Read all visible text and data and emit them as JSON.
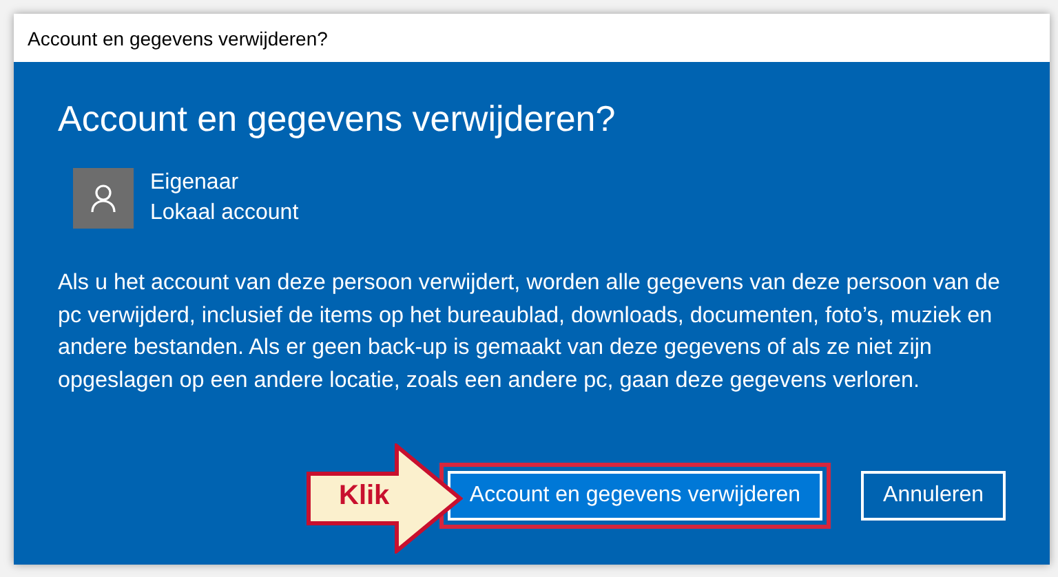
{
  "window": {
    "title": "Account en gegevens verwijderen?"
  },
  "heading": "Account en gegevens verwijderen?",
  "account": {
    "name": "Eigenaar",
    "type": "Lokaal account"
  },
  "message": "Als u het account van deze persoon verwijdert, worden alle gegevens van deze persoon van de pc verwijderd, inclusief de items op het bureaublad, downloads, documenten, foto’s, muziek en andere bestanden. Als er geen back-up is gemaakt van deze gegevens of als ze niet zijn opgeslagen op een andere locatie, zoals een andere pc, gaan deze gegevens verloren.",
  "buttons": [
    {
      "label": "Account en gegevens verwijderen",
      "kind": "primary",
      "highlighted": true
    },
    {
      "label": "Annuleren",
      "kind": "secondary",
      "highlighted": false
    }
  ],
  "callout": {
    "label": "Klik"
  }
}
